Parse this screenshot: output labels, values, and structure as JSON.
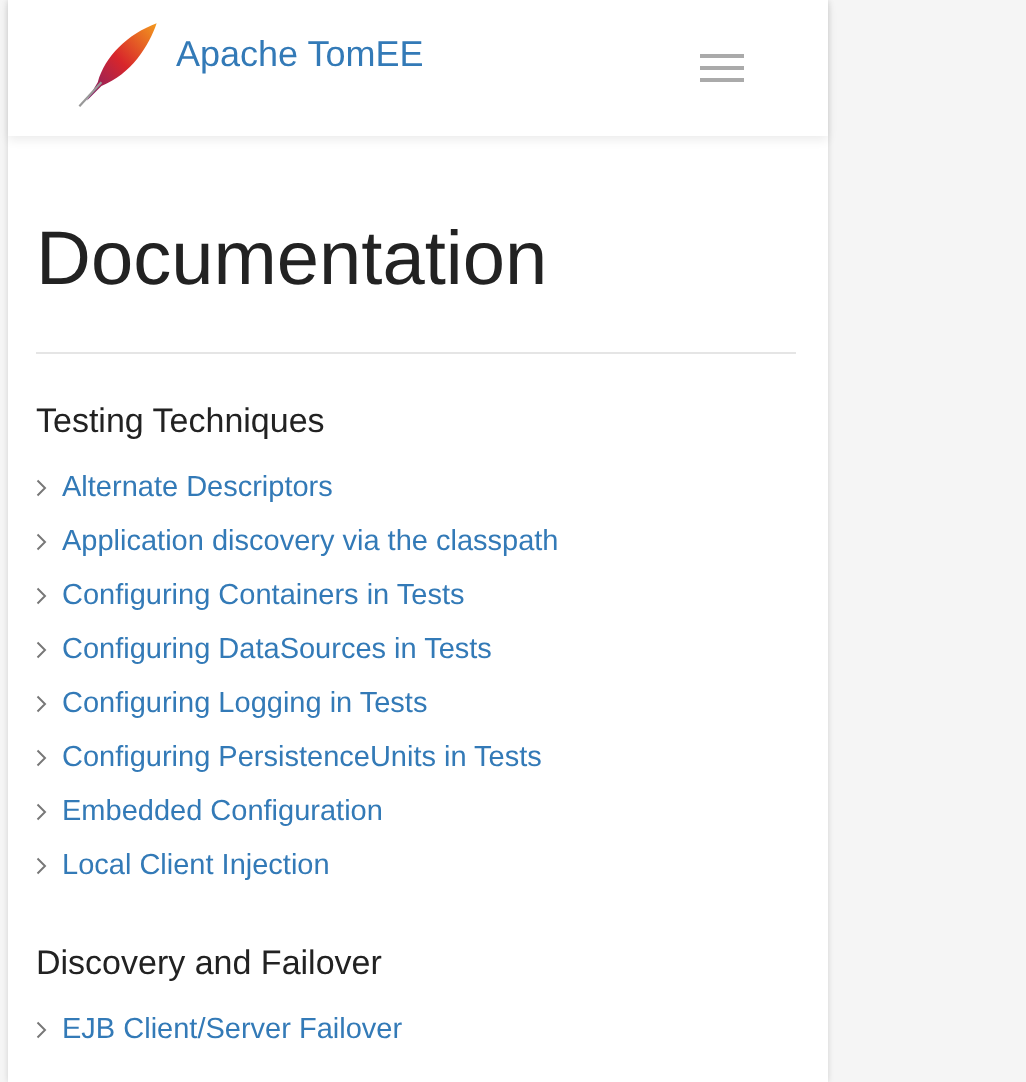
{
  "brand": {
    "name": "Apache TomEE"
  },
  "page": {
    "title": "Documentation"
  },
  "sections": [
    {
      "heading": "Testing Techniques",
      "links": [
        "Alternate Descriptors",
        "Application discovery via the classpath",
        "Configuring Containers in Tests",
        "Configuring DataSources in Tests",
        "Configuring Logging in Tests",
        "Configuring PersistenceUnits in Tests",
        "Embedded Configuration",
        "Local Client Injection"
      ]
    },
    {
      "heading": "Discovery and Failover",
      "links": [
        "EJB Client/Server Failover"
      ]
    }
  ]
}
